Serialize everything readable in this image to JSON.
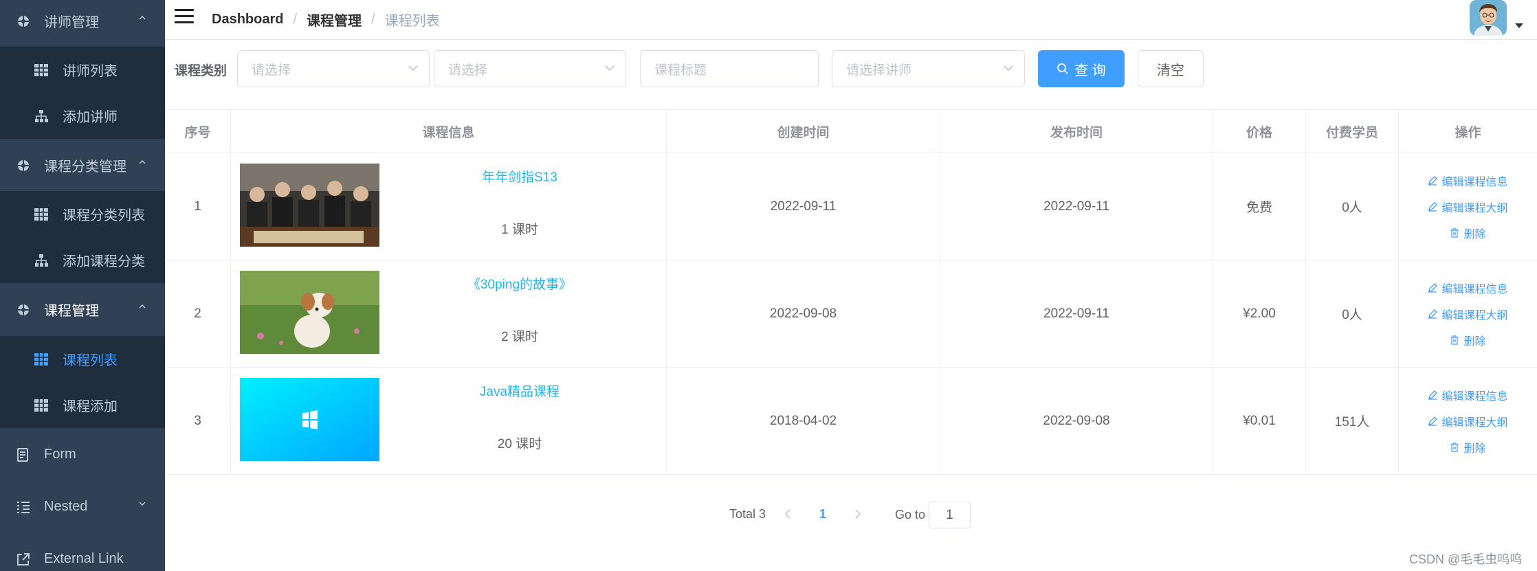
{
  "sidebar": {
    "items": [
      {
        "label": "讲师管理",
        "icon": "component-icon",
        "type": "top",
        "expanded": true
      },
      {
        "label": "讲师列表",
        "icon": "table-icon",
        "type": "sub"
      },
      {
        "label": "添加讲师",
        "icon": "tree-icon",
        "type": "sub"
      },
      {
        "label": "课程分类管理",
        "icon": "component-icon",
        "type": "top",
        "expanded": true
      },
      {
        "label": "课程分类列表",
        "icon": "table-icon",
        "type": "sub"
      },
      {
        "label": "添加课程分类",
        "icon": "tree-icon",
        "type": "sub"
      },
      {
        "label": "课程管理",
        "icon": "component-icon",
        "type": "top",
        "expanded": true
      },
      {
        "label": "课程列表",
        "icon": "table-icon",
        "type": "sub",
        "active": true
      },
      {
        "label": "课程添加",
        "icon": "table-icon",
        "type": "sub"
      },
      {
        "label": "Form",
        "icon": "form-icon",
        "type": "top"
      },
      {
        "label": "Nested",
        "icon": "nested-icon",
        "type": "top",
        "expanded": false
      },
      {
        "label": "External Link",
        "icon": "link-icon",
        "type": "top"
      }
    ],
    "bg_color": "#304156",
    "sub_bg_color": "#1f2d3d",
    "active_color": "#409eff"
  },
  "header": {
    "breadcrumb": [
      "Dashboard",
      "课程管理",
      "课程列表"
    ],
    "separator": "/"
  },
  "filters": {
    "label": "课程类别",
    "category1_placeholder": "请选择",
    "category2_placeholder": "请选择",
    "title_placeholder": "课程标题",
    "teacher_placeholder": "请选择讲师",
    "query_label": "查 询",
    "clear_label": "清空"
  },
  "table": {
    "columns": [
      "序号",
      "课程信息",
      "创建时间",
      "发布时间",
      "价格",
      "付费学员",
      "操作"
    ],
    "rows": [
      {
        "index": "1",
        "title": "年年剑指S13",
        "hours": "1 课时",
        "created": "2022-09-11",
        "published": "2022-09-11",
        "price": "免费",
        "students": "0人",
        "thumb": "team-photo"
      },
      {
        "index": "2",
        "title": "《30ping的故事》",
        "hours": "2 课时",
        "created": "2022-09-08",
        "published": "2022-09-11",
        "price": "¥2.00",
        "students": "0人",
        "thumb": "puppy-photo"
      },
      {
        "index": "3",
        "title": "Java精品课程",
        "hours": "20 课时",
        "created": "2018-04-02",
        "published": "2022-09-08",
        "price": "¥0.01",
        "students": "151人",
        "thumb": "windows-logo"
      }
    ],
    "actions": {
      "edit_info": "编辑课程信息",
      "edit_outline": "编辑课程大纲",
      "delete": "删除"
    }
  },
  "pagination": {
    "total": "Total 3",
    "current_page": "1",
    "goto_label": "Go to",
    "goto_value": "1"
  },
  "watermark": "CSDN @毛毛虫呜呜"
}
